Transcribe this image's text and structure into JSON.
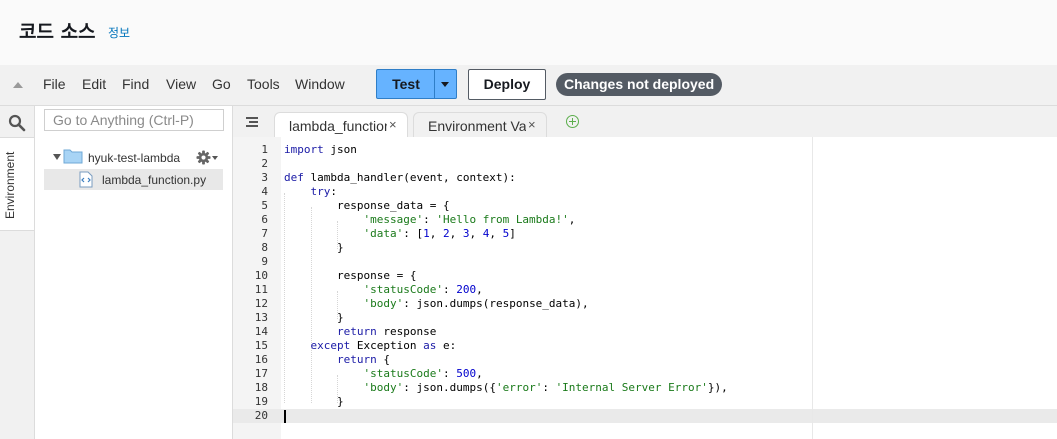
{
  "header": {
    "title": "코드 소스",
    "info_link": "정보"
  },
  "menu": {
    "collapse_icon": "triangle-up-icon",
    "items": [
      "File",
      "Edit",
      "Find",
      "View",
      "Go",
      "Tools",
      "Window"
    ]
  },
  "toolbar": {
    "test_label": "Test",
    "deploy_label": "Deploy",
    "status_badge": "Changes not deployed",
    "test_color": "#66b3ff"
  },
  "sidebar": {
    "search_placeholder": "Go to Anything (Ctrl-P)",
    "environment_tab": "Environment",
    "folder": "hyuk-test-lambda",
    "folder_dash": "-",
    "file": "lambda_function.py"
  },
  "tabs": [
    {
      "label": "lambda_function",
      "close": "×",
      "active": true
    },
    {
      "label": "Environment Vari",
      "close": "×",
      "active": false
    }
  ],
  "code": {
    "lines": [
      "import json",
      "",
      "def lambda_handler(event, context):",
      "    try:",
      "        response_data = {",
      "            'message': 'Hello from Lambda!',",
      "            'data': [1, 2, 3, 4, 5]",
      "        }",
      "",
      "        response = {",
      "            'statusCode': 200,",
      "            'body': json.dumps(response_data),",
      "        }",
      "        return response",
      "    except Exception as e:",
      "        return {",
      "            'statusCode': 500,",
      "            'body': json.dumps({'error': 'Internal Server Error'}),",
      "        }",
      ""
    ],
    "active_line": 20
  },
  "colors": {
    "keyword": "#1a1aa6",
    "string": "#1a7a1a",
    "number": "#0000cd",
    "badge": "#545b64",
    "link": "#0073bb"
  }
}
